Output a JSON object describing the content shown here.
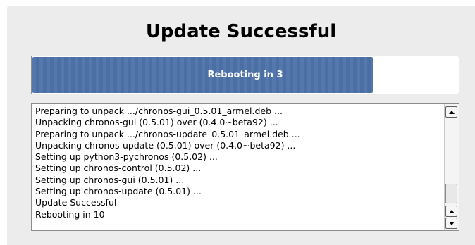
{
  "dialog": {
    "title": "Update Successful"
  },
  "progress": {
    "label": "Rebooting in 3",
    "fraction": 0.8,
    "fill_color": "#5478ad"
  },
  "log": {
    "lines": [
      "Preparing to unpack .../chronos-gui_0.5.01_armel.deb ...",
      "Unpacking chronos-gui (0.5.01) over (0.4.0~beta92) ...",
      "Preparing to unpack .../chronos-update_0.5.01_armel.deb ...",
      "Unpacking chronos-update (0.5.01) over (0.4.0~beta92) ...",
      "Setting up python3-pychronos (0.5.02) ...",
      "Setting up chronos-control (0.5.02) ...",
      "Setting up chronos-gui (0.5.01) ...",
      "Setting up chronos-update (0.5.01) ...",
      "Update Successful",
      "Rebooting in 10"
    ]
  },
  "scrollbar": {
    "up_icon": "arrow-up-icon",
    "down_icon": "arrow-down-icon"
  }
}
